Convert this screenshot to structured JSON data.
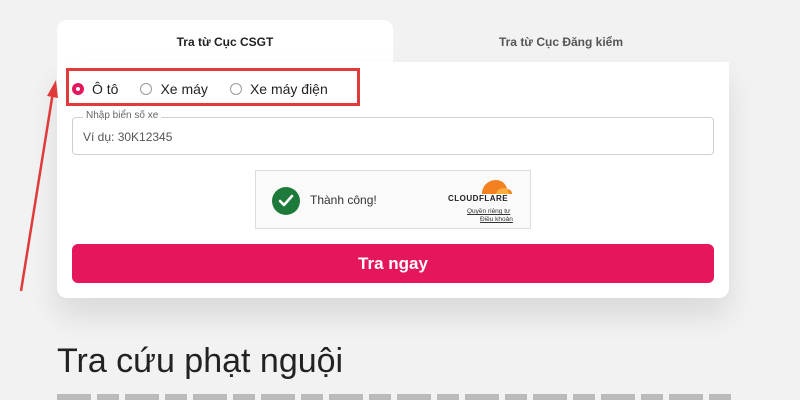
{
  "tabs": [
    {
      "label": "Tra từ Cục CSGT",
      "active": true
    },
    {
      "label": "Tra từ Cục Đăng kiểm",
      "active": false
    }
  ],
  "vehicle_types": {
    "selected": "Ô tô",
    "options": [
      "Ô tô",
      "Xe máy",
      "Xe máy điện"
    ]
  },
  "plate_field": {
    "label": "Nhập biển số xe",
    "placeholder": "Ví dụ: 30K12345",
    "value": ""
  },
  "captcha": {
    "status": "Thành công!",
    "provider": "CLOUDFLARE",
    "privacy_link": "Quyền riêng tư",
    "terms_link": "Điều khoản"
  },
  "submit_label": "Tra ngay",
  "heading": "Tra cứu phạt nguội",
  "icons": {
    "check": "check-circle-icon",
    "cloudflare": "cloudflare-logo-icon",
    "radio": "radio-icon"
  },
  "colors": {
    "accent": "#e6165c",
    "annotation": "#e03a3a",
    "success": "#1e7a3a",
    "cloudflare_orange": "#f48120"
  }
}
